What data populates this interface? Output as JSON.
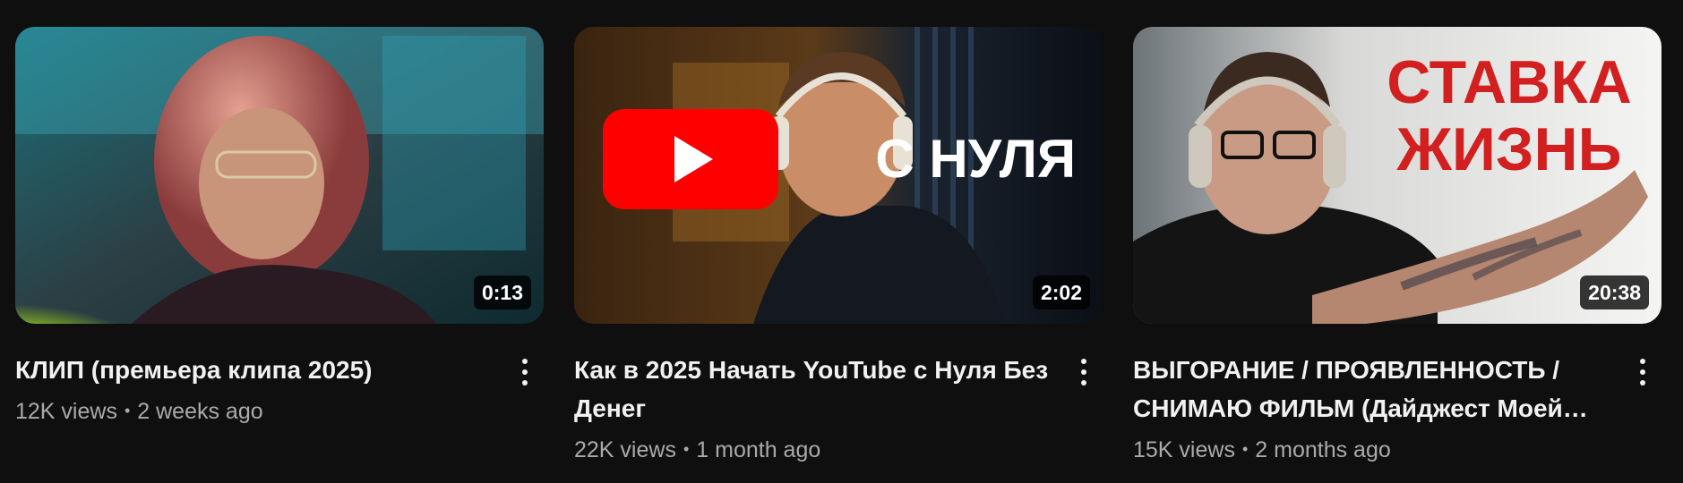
{
  "videos": [
    {
      "title": "КЛИП (премьера клипа 2025)",
      "views": "12K views",
      "age": "2 weeks ago",
      "duration": "0:13",
      "thumbnail_text": []
    },
    {
      "title": "Как в 2025 Начать YouTube с Нуля Без Денег",
      "views": "22K views",
      "age": "1 month ago",
      "duration": "2:02",
      "thumbnail_text": [
        "С НУЛЯ"
      ]
    },
    {
      "title": "ВЫГОРАНИЕ / ПРОЯВЛЕННОСТЬ / СНИМАЮ ФИЛЬМ (Дайджест Моей…",
      "views": "15K views",
      "age": "2 months ago",
      "duration": "20:38",
      "thumbnail_text": [
        "СТАВКА",
        "ЖИЗНЬ"
      ]
    }
  ],
  "separator": "•",
  "icons": {
    "menu": "more-vert-icon",
    "play": "youtube-play-icon"
  },
  "colors": {
    "background": "#0f0f0f",
    "title": "#f1f1f1",
    "meta": "#aaaaaa",
    "youtube_red": "#ff0000",
    "thumbnail_red_text": "#d21f1f"
  }
}
